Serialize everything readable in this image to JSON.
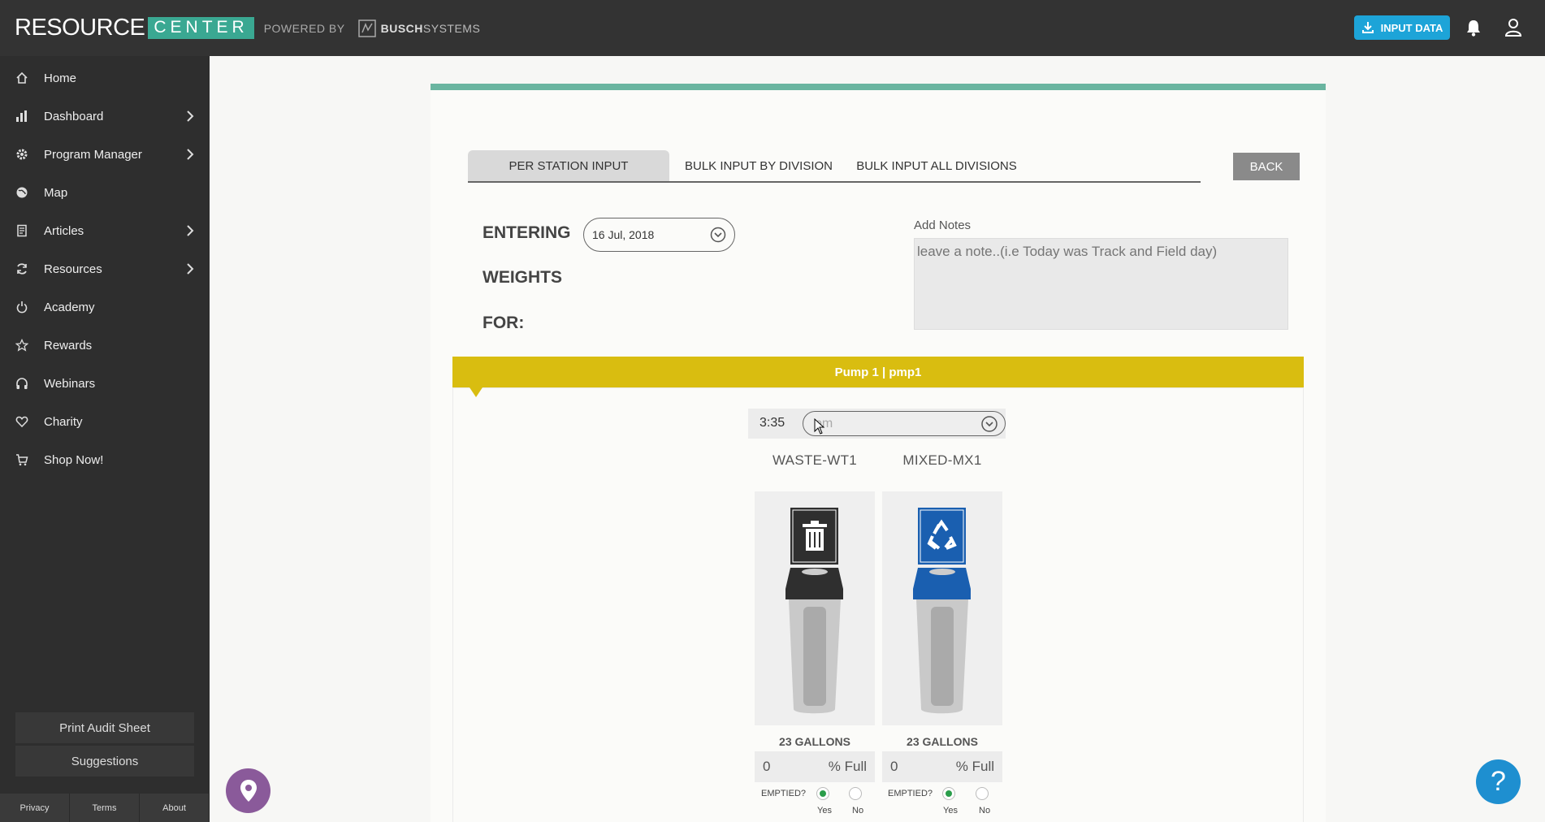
{
  "brand": {
    "resource": "RESOURCE",
    "center": "CENTER",
    "powered_by": "POWERED BY",
    "busch_bold": "BUSCH",
    "busch_rest": "SYSTEMS"
  },
  "header": {
    "input_data_label": "INPUT DATA",
    "input_data_icon": "download-icon",
    "notification_icon": "bell-icon",
    "account_icon": "user-icon"
  },
  "sidebar": {
    "items": [
      {
        "label": "Home",
        "icon": "home-icon",
        "has_submenu": false
      },
      {
        "label": "Dashboard",
        "icon": "bar-chart-icon",
        "has_submenu": true
      },
      {
        "label": "Program Manager",
        "icon": "gear-icon",
        "has_submenu": true
      },
      {
        "label": "Map",
        "icon": "globe-icon",
        "has_submenu": false
      },
      {
        "label": "Articles",
        "icon": "document-icon",
        "has_submenu": true
      },
      {
        "label": "Resources",
        "icon": "refresh-icon",
        "has_submenu": true
      },
      {
        "label": "Academy",
        "icon": "power-icon",
        "has_submenu": false
      },
      {
        "label": "Rewards",
        "icon": "star-icon",
        "has_submenu": false
      },
      {
        "label": "Webinars",
        "icon": "headphones-icon",
        "has_submenu": false
      },
      {
        "label": "Charity",
        "icon": "heart-icon",
        "has_submenu": false
      },
      {
        "label": "Shop Now!",
        "icon": "cart-icon",
        "has_submenu": false
      }
    ],
    "print_audit_sheet": "Print Audit Sheet",
    "suggestions": "Suggestions",
    "footer": [
      "Privacy",
      "Terms",
      "About"
    ]
  },
  "main": {
    "tabs": [
      {
        "label": "PER STATION INPUT",
        "active": true
      },
      {
        "label": "BULK INPUT BY DIVISION",
        "active": false
      },
      {
        "label": "BULK INPUT ALL DIVISIONS",
        "active": false
      }
    ],
    "back_label": "BACK",
    "entering_label": "ENTERING",
    "weights_label": "WEIGHTS",
    "for_label": "FOR:",
    "date_value": "16 Jul, 2018",
    "notes_label": "Add Notes",
    "notes_placeholder": "leave a note..(i.e Today was Track and Field day)",
    "station_title": "Pump 1 | pmp1",
    "time_value": "3:35",
    "ampm_placeholder": "pm",
    "bins": [
      {
        "name": "WASTE-WT1",
        "capacity": "23 GALLONS",
        "fill_value": "0",
        "fill_unit": "% Full",
        "emptied_label": "EMPTIED?",
        "yes_label": "Yes",
        "no_label": "No",
        "emptied": "Yes",
        "icon": "trash-icon",
        "lid_color": "#2f2f2f"
      },
      {
        "name": "MIXED-MX1",
        "capacity": "23 GALLONS",
        "fill_value": "0",
        "fill_unit": "% Full",
        "emptied_label": "EMPTIED?",
        "yes_label": "Yes",
        "no_label": "No",
        "emptied": "Yes",
        "icon": "recycle-icon",
        "lid_color": "#1a5fb0"
      }
    ]
  },
  "colors": {
    "accent_teal": "#3aa892",
    "station_yellow": "#d9bd10",
    "button_blue": "#1da4d8",
    "map_purple": "#8a5a9a",
    "help_blue": "#1e8fd0"
  },
  "help_label": "?"
}
